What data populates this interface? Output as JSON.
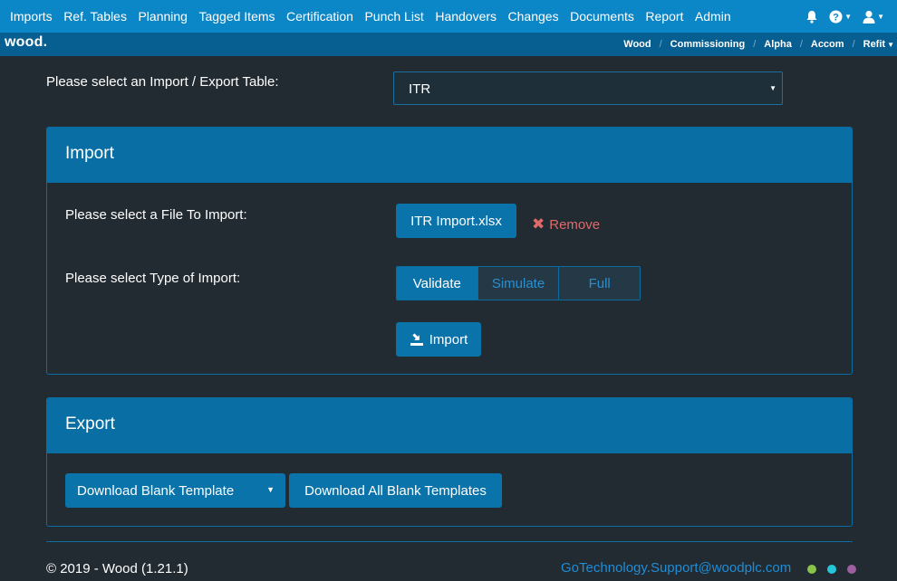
{
  "nav": {
    "menu": [
      "Imports",
      "Ref. Tables",
      "Planning",
      "Tagged Items",
      "Certification",
      "Punch List",
      "Handovers",
      "Changes",
      "Documents",
      "Report",
      "Admin"
    ],
    "icons": [
      "bell-icon",
      "help-icon",
      "user-icon"
    ]
  },
  "subbar": {
    "logo": "wood",
    "logo_dot": ".",
    "breadcrumbs": [
      "Wood",
      "Commissioning",
      "Alpha",
      "Accom",
      "Refit"
    ]
  },
  "table_select": {
    "label": "Please select an Import / Export Table:",
    "value": "ITR"
  },
  "import_panel": {
    "title": "Import",
    "file_label": "Please select a File To Import:",
    "file_name": "ITR Import.xlsx",
    "remove_label": "Remove",
    "type_label": "Please select Type of Import:",
    "types": [
      "Validate",
      "Simulate",
      "Full"
    ],
    "selected_type": "Validate",
    "import_button": "Import"
  },
  "export_panel": {
    "title": "Export",
    "download_blank": "Download Blank Template",
    "download_all": "Download All Blank Templates"
  },
  "footer": {
    "copyright": "© 2019 - Wood (1.21.1)",
    "email": "GoTechnology.Support@woodplc.com",
    "dot_colors": [
      "#8bc34a",
      "#26c6da",
      "#9c5fa0"
    ]
  },
  "colors": {
    "nav_bg": "#0b86c6",
    "subbar_bg": "#075e91",
    "page_bg": "#232b32",
    "accent": "#0a73aa",
    "danger": "#e06a6a"
  }
}
